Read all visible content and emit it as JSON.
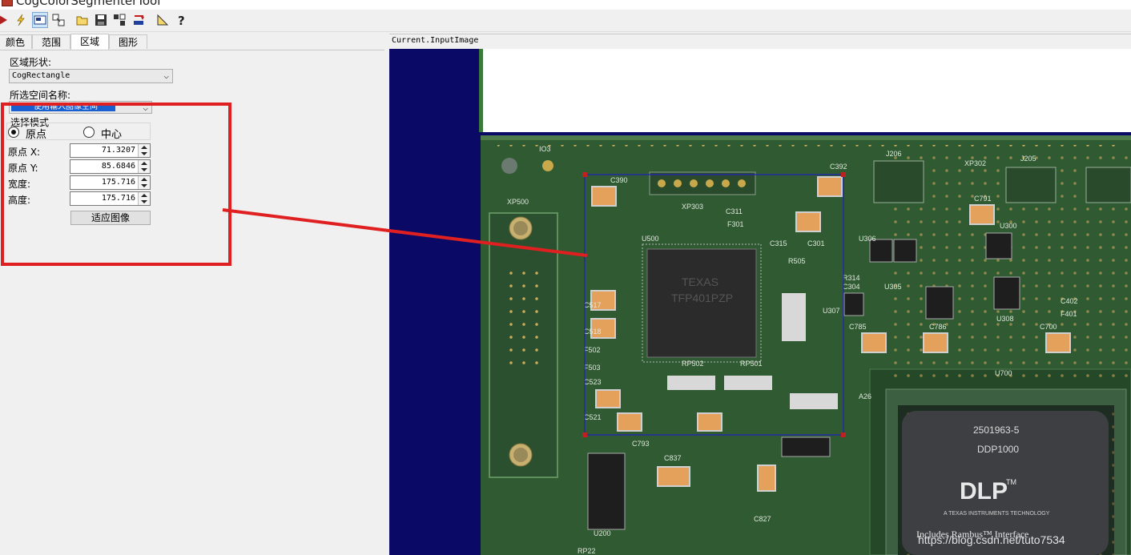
{
  "window": {
    "title": "CogColorSegmenterTool"
  },
  "toolbar": {
    "buttons": [
      "run-icon",
      "lightning-icon",
      "display-icon",
      "link-icon",
      "open-icon",
      "save-icon",
      "reset-icon",
      "load-image-icon",
      "measure-icon",
      "help-icon"
    ]
  },
  "tabs": [
    {
      "label": "颜色"
    },
    {
      "label": "范围"
    },
    {
      "label": "区域",
      "active": true
    },
    {
      "label": "图形"
    }
  ],
  "region": {
    "shape_label": "区域形状:",
    "shape_value": "CogRectangle",
    "space_label": "所选空间名称:",
    "space_value": "使用输入图像空间",
    "mode_label": "选择模式",
    "mode_options": [
      "原点",
      "中心"
    ],
    "mode_selected": "原点",
    "fields": [
      {
        "label": "原点 X:",
        "value": "71.3207"
      },
      {
        "label": "原点 Y:",
        "value": "85.6846"
      },
      {
        "label": "宽度:",
        "value": "175.716"
      },
      {
        "label": "高度:",
        "value": "175.716"
      }
    ],
    "fit_button": "适应图像"
  },
  "display": {
    "caption": "Current.InputImage",
    "board_labels": [
      "IO3",
      "XP500",
      "XP303",
      "C390",
      "C392",
      "C311",
      "F301",
      "C315",
      "C301",
      "U500",
      "R505",
      "C517",
      "C518",
      "F502",
      "F503",
      "C523",
      "C521",
      "C793",
      "RP502",
      "RP501",
      "U307",
      "R314",
      "C304",
      "U305",
      "C785",
      "C786",
      "C700",
      "J206",
      "J205",
      "XP302",
      "C791",
      "U300",
      "U306",
      "C402",
      "F401",
      "U308",
      "U700",
      "A26",
      "C837",
      "U200",
      "C827",
      "RP22"
    ],
    "chip_lines": [
      "TEXAS",
      "TFP401PZP"
    ],
    "dlp_chip": [
      "2501963-5",
      "DDP1000",
      "DLP",
      "TM",
      "A TEXAS INSTRUMENTS TECHNOLOGY",
      "Includes Rambus™ Interface"
    ],
    "watermark": "https://blog.csdn.net/tuto7534"
  },
  "colors": {
    "annotation_red": "#e02020",
    "roi_blue": "#2020c0",
    "pcb_green": "#2f5a32",
    "display_background": "#0a0a66"
  }
}
